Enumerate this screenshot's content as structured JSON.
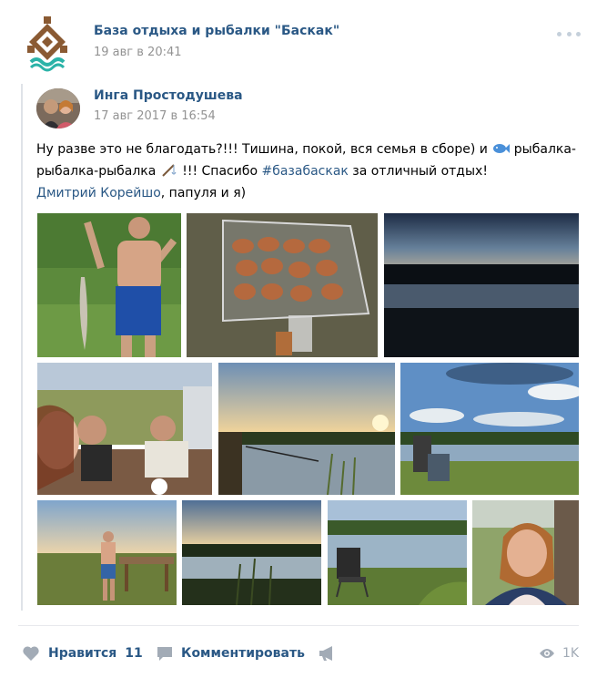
{
  "post": {
    "group_name": "База отдыха и рыбалки \"Баскак\"",
    "date": "19 авг в 20:41"
  },
  "repost": {
    "author": "Инга Простодушева",
    "date": "17 авг 2017 в 16:54",
    "text": {
      "part1": "Ну разве это не благодать?!!! Тишина, покой, вся семья в сборе) и ",
      "part2": " рыбалка-рыбалка-рыбалка ",
      "part3": " !!! Спасибо ",
      "hashtag": "#базабаскак",
      "part4": " за отличный отдых!",
      "mention": "Дмитрий Корейшо",
      "part5": ", папуля и я)"
    },
    "photos": [
      {
        "name": "photo-man-with-fish"
      },
      {
        "name": "photo-grill-meat"
      },
      {
        "name": "photo-lake-sunset-dark"
      },
      {
        "name": "photo-family-selfie-table"
      },
      {
        "name": "photo-sunset-fishing"
      },
      {
        "name": "photo-clouds-lake"
      },
      {
        "name": "photo-man-at-table"
      },
      {
        "name": "photo-lake-dusk"
      },
      {
        "name": "photo-lake-chair"
      },
      {
        "name": "photo-woman-selfie"
      }
    ]
  },
  "actions": {
    "like_label": "Нравится",
    "like_count": "11",
    "comment_label": "Комментировать",
    "views": "1K"
  },
  "icons": {
    "like": "heart-icon",
    "comment": "comment-icon",
    "share": "megaphone-icon",
    "views": "eye-icon",
    "emoji_fish": "fish-emoji-icon",
    "emoji_rod": "fishing-rod-emoji-icon"
  },
  "colors": {
    "link": "#2a5885",
    "meta": "#939393",
    "icon": "#a2abb6",
    "repost_bar": "#dfe3e8"
  }
}
